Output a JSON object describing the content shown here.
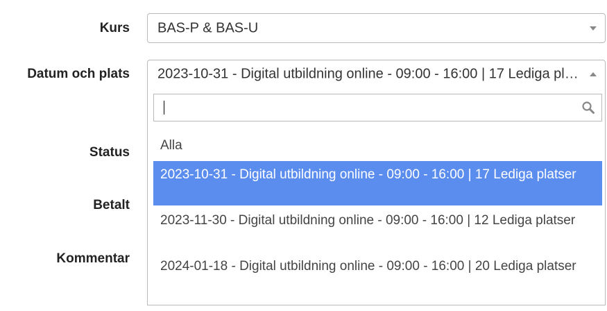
{
  "form": {
    "kurs_label": "Kurs",
    "kurs_value": "BAS-P & BAS-U",
    "datum_label": "Datum och plats",
    "datum_value": "2023-10-31 - Digital utbildning online - 09:00 - 16:00 | 17 Lediga platser",
    "status_label": "Status",
    "betalt_label": "Betalt",
    "kommentar_label": "Kommentar"
  },
  "dropdown": {
    "search_value": "",
    "search_icon": "search-icon",
    "options": [
      "Alla",
      "2023-10-31 - Digital utbildning online - 09:00 - 16:00 | 17 Lediga platser",
      "2023-11-30 - Digital utbildning online - 09:00 - 16:00 | 12 Lediga platser",
      "2024-01-18 - Digital utbildning online - 09:00 - 16:00 | 20 Lediga platser"
    ],
    "highlighted_index": 1
  },
  "colors": {
    "highlight": "#5b8def",
    "border": "#b9b9b9"
  }
}
